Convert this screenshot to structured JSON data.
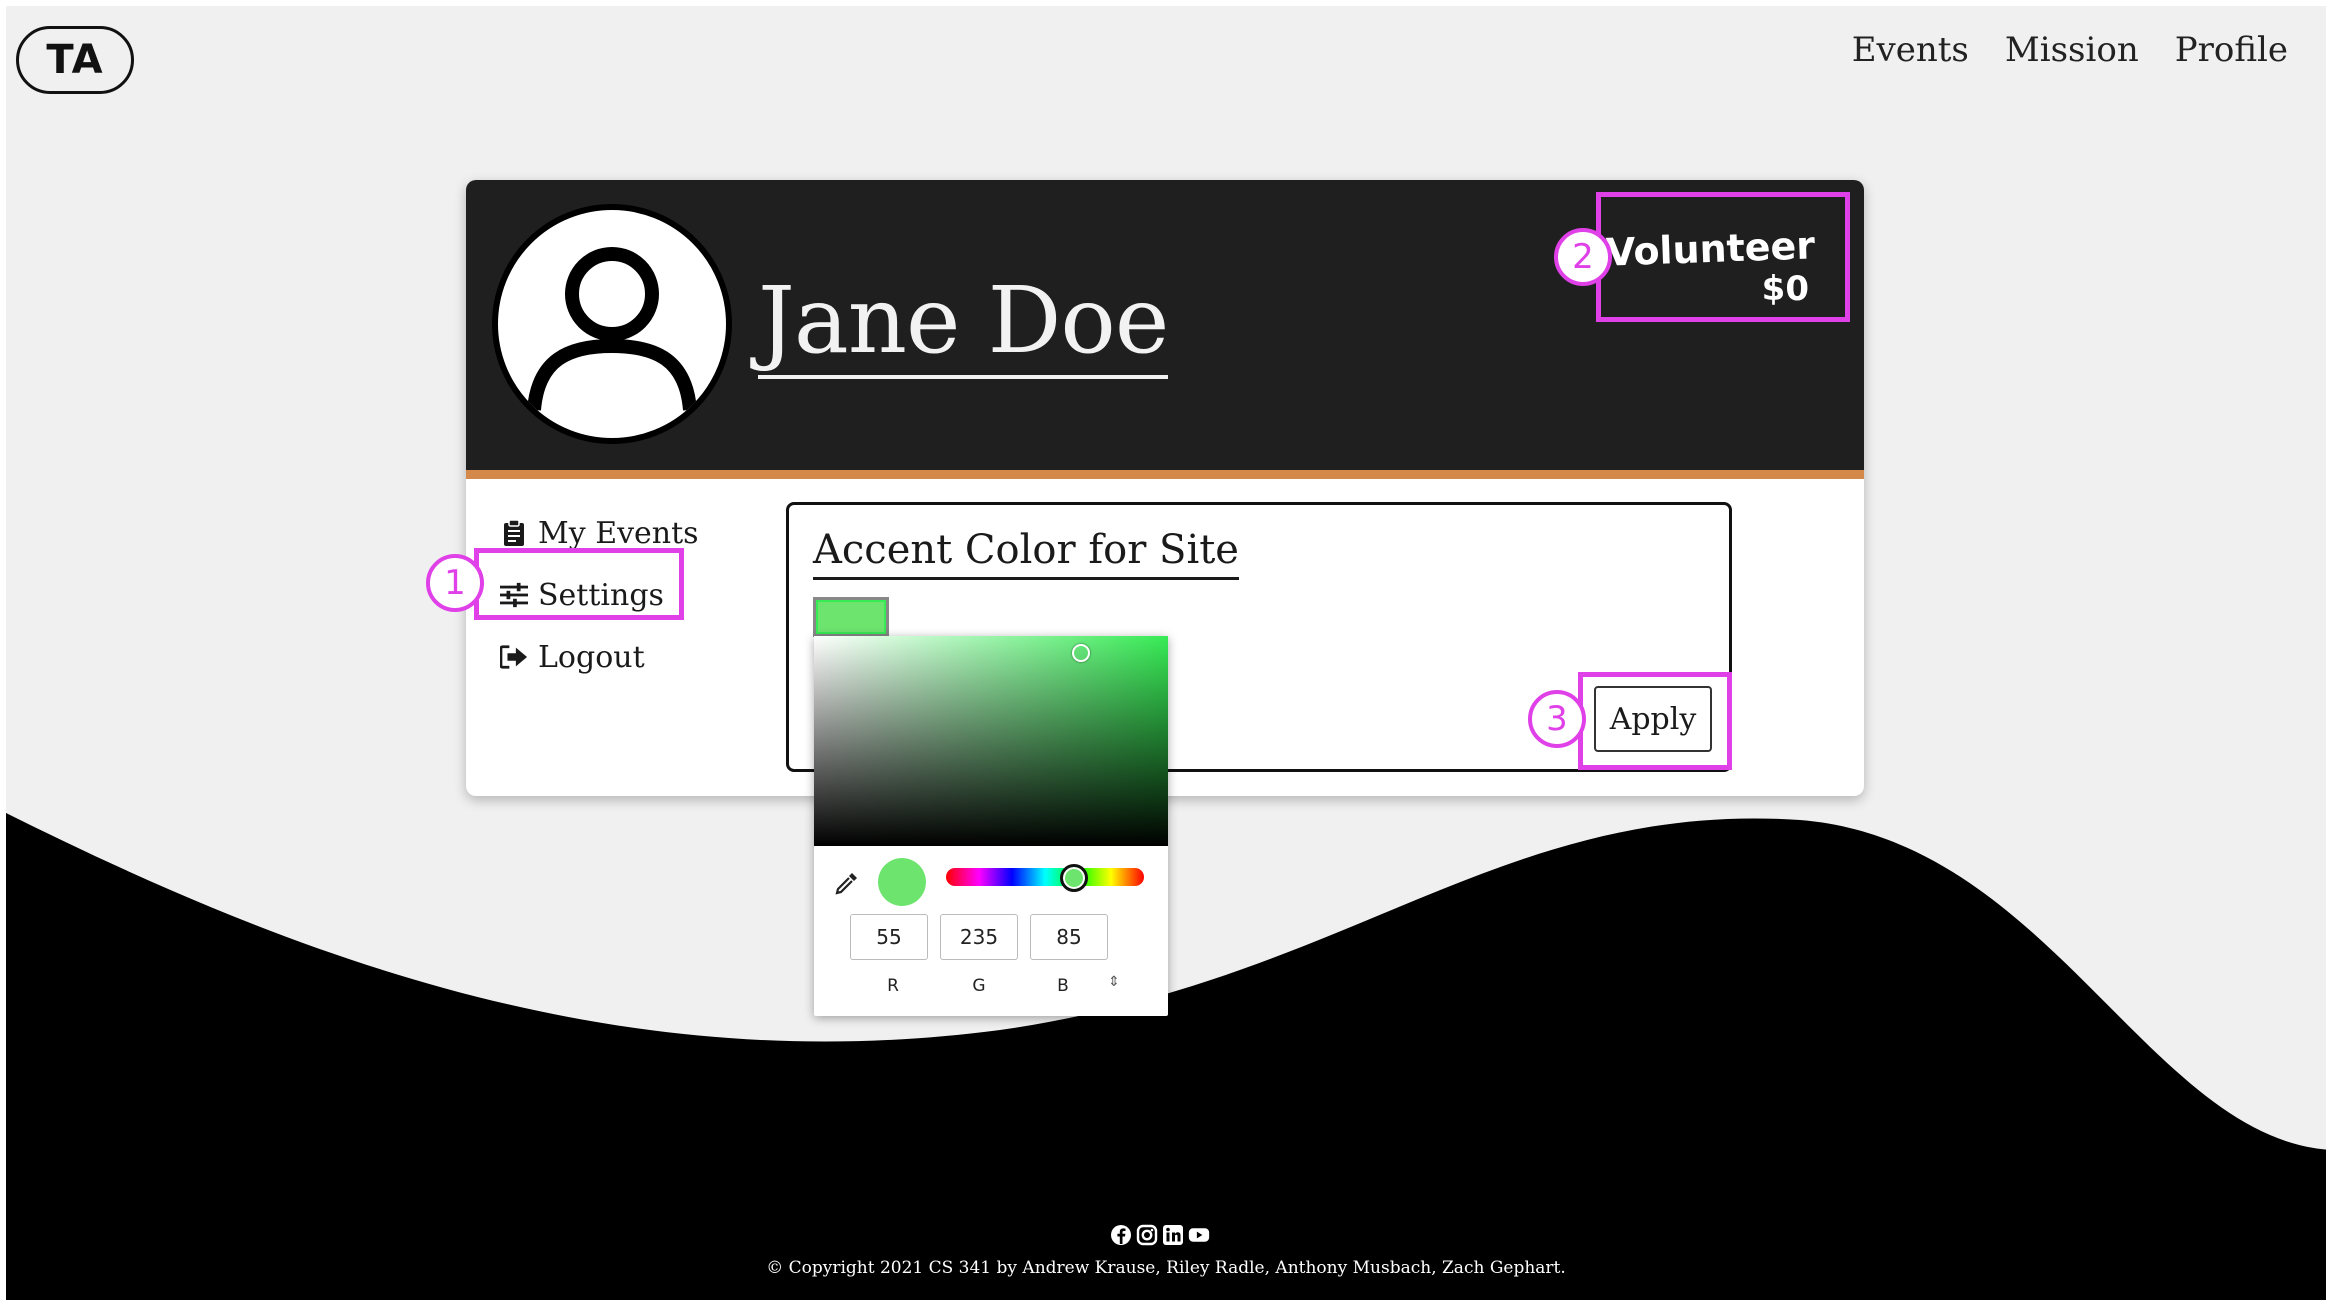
{
  "logo": {
    "text": "TA"
  },
  "nav": {
    "items": [
      "Events",
      "Mission",
      "Profile"
    ]
  },
  "profile": {
    "name": "Jane Doe",
    "role": "Volunteer",
    "amount": "$0"
  },
  "menu": {
    "items": [
      {
        "label": "My Events",
        "icon": "clipboard-icon"
      },
      {
        "label": "Settings",
        "icon": "sliders-icon"
      },
      {
        "label": "Logout",
        "icon": "logout-icon"
      }
    ]
  },
  "settings": {
    "title": "Accent Color for Site",
    "apply_label": "Apply",
    "swatch_color": "#6de46e"
  },
  "color_picker": {
    "r": "55",
    "g": "235",
    "b": "85",
    "labels": [
      "R",
      "G",
      "B"
    ],
    "mode_toggle": "⇕"
  },
  "annotations": [
    "1",
    "2",
    "3"
  ],
  "colors": {
    "accent_bar": "#d4894a",
    "highlight": "#e040e8",
    "header_bg": "#1f1f1f"
  },
  "footer": {
    "social_icons": [
      "facebook-icon",
      "instagram-icon",
      "linkedin-icon",
      "youtube-icon"
    ],
    "copyright": "© Copyright 2021 CS 341 by Andrew Krause, Riley Radle, Anthony Musbach, Zach Gephart."
  }
}
